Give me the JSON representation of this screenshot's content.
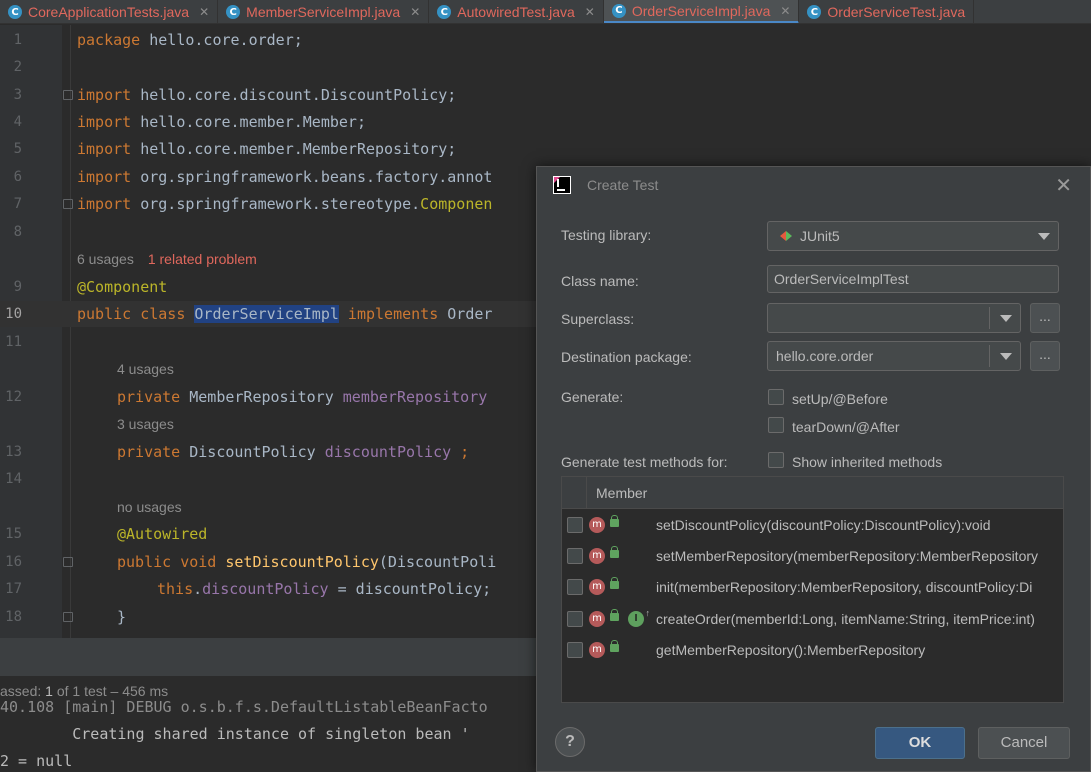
{
  "tabs": [
    {
      "name": "CoreApplicationTests.java"
    },
    {
      "name": "MemberServiceImpl.java"
    },
    {
      "name": "AutowiredTest.java"
    },
    {
      "name": "OrderServiceImpl.java"
    },
    {
      "name": "OrderServiceTest.java"
    }
  ],
  "editor": {
    "line_numbers": [
      "1",
      "2",
      "3",
      "4",
      "5",
      "6",
      "7",
      "8",
      "9",
      "10",
      "11",
      "12",
      "13",
      "14",
      "15",
      "16",
      "17",
      "18"
    ],
    "l1_kw": "package",
    "l1_rest": " hello.core.order;",
    "import_kw": "import",
    "imp3": " hello.core.discount.DiscountPolicy;",
    "imp4": " hello.core.member.Member;",
    "imp5": " hello.core.member.MemberRepository;",
    "imp6": " org.springframework.beans.factory.annot",
    "imp7a": " org.springframework.stereotype.",
    "imp7b": "Componen",
    "hint_usages_6": "6 usages",
    "hint_problem": "1 related problem",
    "ann_component": "@Component",
    "l10_kw1": "public class ",
    "l10_cls": "OrderServiceImpl",
    "l10_kw2": " implements",
    "l10_rest": " Order",
    "hint_usages_4": "4 usages",
    "l12_kw": "private",
    "l12_type": " MemberRepository ",
    "l12_fld": "memberRepository",
    "hint_usages_3": "3 usages",
    "l13_kw": "private",
    "l13_type": " DiscountPolicy ",
    "l13_fld": "discountPolicy",
    "l13_end": " ;",
    "hint_no_usages": "no usages",
    "ann_autowired": "@Autowired",
    "l16_kw": "public void ",
    "l16_fn": "setDiscountPolicy",
    "l16_rest": "(DiscountPoli",
    "l17_kw": "this",
    "l17_dot": ".",
    "l17_fld": "discountPolicy",
    "l17_rest": " = discountPolicy;",
    "l18": "}"
  },
  "run": {
    "status_prefix": "assed: ",
    "status_count": "1",
    "status_rest": " of 1 test – 456 ms",
    "console_line1": "40.108 [main] DEBUG o.s.b.f.s.DefaultListableBeanFacto",
    "console_line2": "        Creating shared instance of singleton bean '",
    "console_line3": "2 = null"
  },
  "dialog": {
    "title": "Create Test",
    "close_glyph": "✕",
    "testing_library_label": "Testing library:",
    "testing_library_value": "JUnit5",
    "class_name_label": "Class name:",
    "class_name_value": "OrderServiceImplTest",
    "superclass_label": "Superclass:",
    "superclass_value": "",
    "destination_label": "Destination package:",
    "destination_value": "hello.core.order",
    "browse_label": "...",
    "generate_label": "Generate:",
    "setup_label": "setUp/@Before",
    "teardown_label": "tearDown/@After",
    "generate_methods_label": "Generate test methods for:",
    "show_inherited_label": "Show inherited methods",
    "member_header": "Member",
    "method_icon": "m",
    "interface_icon": "I",
    "members": [
      {
        "signature": "setDiscountPolicy(discountPolicy:DiscountPolicy):void"
      },
      {
        "signature": "setMemberRepository(memberRepository:MemberRepository"
      },
      {
        "signature": "init(memberRepository:MemberRepository, discountPolicy:Di"
      },
      {
        "signature": "createOrder(memberId:Long, itemName:String, itemPrice:int)"
      },
      {
        "signature": "getMemberRepository():MemberRepository"
      }
    ],
    "help_label": "?",
    "ok_label": "OK",
    "cancel_label": "Cancel"
  }
}
